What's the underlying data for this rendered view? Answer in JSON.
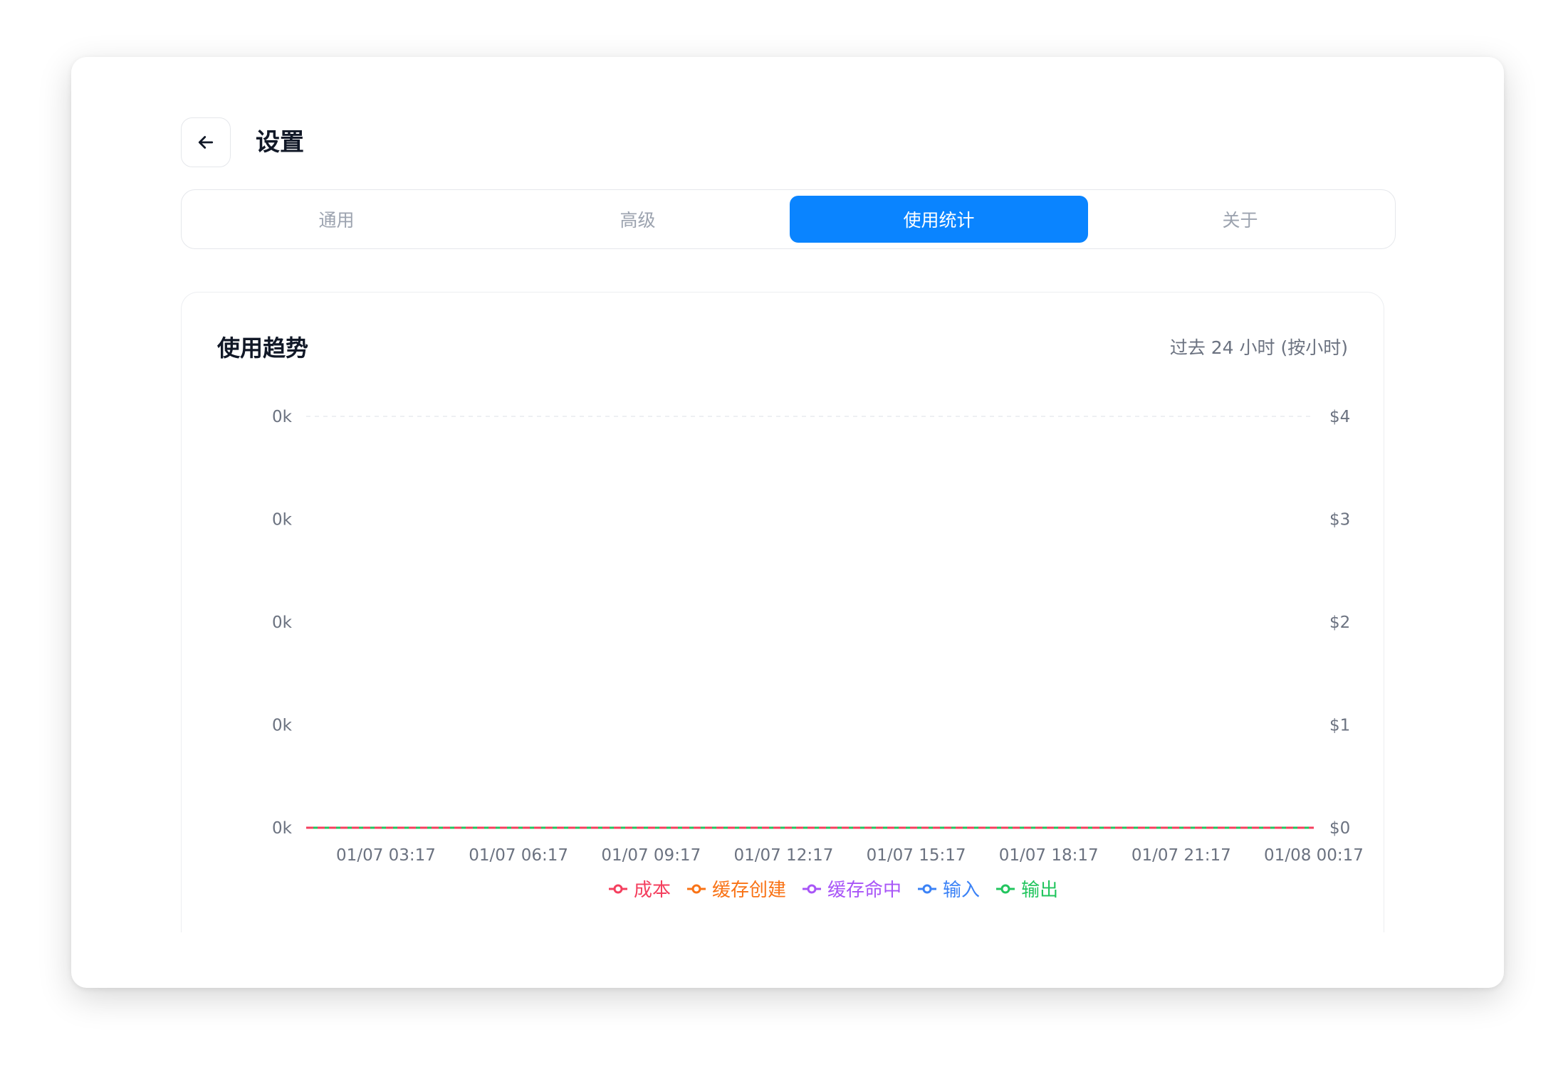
{
  "header": {
    "back_icon": "arrow-left-icon",
    "title": "设置"
  },
  "tabs": [
    {
      "label": "通用",
      "active": false
    },
    {
      "label": "高级",
      "active": false
    },
    {
      "label": "使用统计",
      "active": true
    },
    {
      "label": "关于",
      "active": false
    }
  ],
  "colors": {
    "accent": "#0a84ff",
    "cost": "#f43f5e",
    "cache_create": "#f97316",
    "cache_hit": "#a855f7",
    "input": "#3b82f6",
    "output": "#22c55e"
  },
  "card": {
    "title": "使用趋势",
    "range_label": "过去 24 小时 (按小时)"
  },
  "chart_data": {
    "type": "line",
    "x": [
      "01/07 03:17",
      "01/07 06:17",
      "01/07 09:17",
      "01/07 12:17",
      "01/07 15:17",
      "01/07 18:17",
      "01/07 21:17",
      "01/08 00:17"
    ],
    "y_left_ticks": [
      "0k",
      "0k",
      "0k",
      "0k",
      "0k"
    ],
    "y_right_ticks": [
      "$4",
      "$3",
      "$2",
      "$1",
      "$0"
    ],
    "y_right_range": [
      0,
      4
    ],
    "grid": false,
    "legend_position": "bottom",
    "series": [
      {
        "name": "成本",
        "color": "#f43f5e",
        "axis": "right",
        "values": [
          0,
          0,
          0,
          0,
          0,
          0,
          0,
          0
        ]
      },
      {
        "name": "缓存创建",
        "color": "#f97316",
        "axis": "left",
        "values": [
          0,
          0,
          0,
          0,
          0,
          0,
          0,
          0
        ]
      },
      {
        "name": "缓存命中",
        "color": "#a855f7",
        "axis": "left",
        "values": [
          0,
          0,
          0,
          0,
          0,
          0,
          0,
          0
        ]
      },
      {
        "name": "输入",
        "color": "#3b82f6",
        "axis": "left",
        "values": [
          0,
          0,
          0,
          0,
          0,
          0,
          0,
          0
        ]
      },
      {
        "name": "输出",
        "color": "#22c55e",
        "axis": "left",
        "values": [
          0,
          0,
          0,
          0,
          0,
          0,
          0,
          0
        ]
      }
    ]
  }
}
